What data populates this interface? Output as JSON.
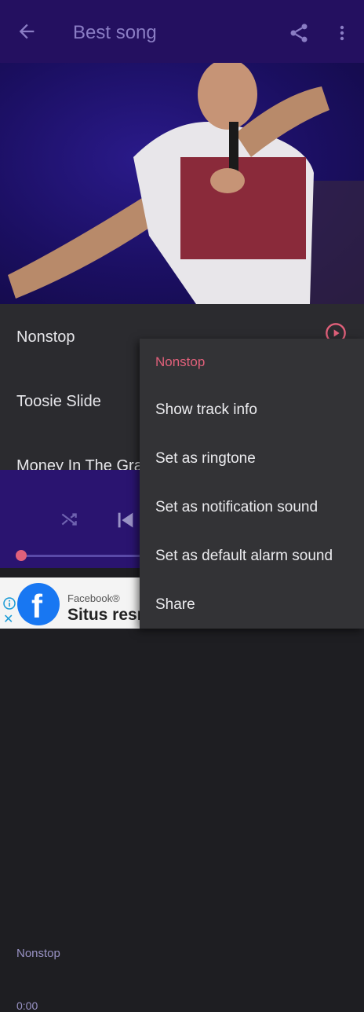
{
  "appbar": {
    "title": "Best song"
  },
  "tracks": [
    "Nonstop",
    "Toosie Slide",
    "Money In The Gra"
  ],
  "player": {
    "now_playing": "Nonstop",
    "elapsed": "0:00",
    "progress": 0
  },
  "ad": {
    "sponsor": "Facebook®",
    "headline": "Situs resmi",
    "logo_letter": "f",
    "close": "✕"
  },
  "menu": {
    "header": "Nonstop",
    "items": [
      "Show track info",
      "Set as ringtone",
      "Set as notification sound",
      "Set as default alarm sound",
      "Share"
    ]
  },
  "colors": {
    "appbar": "#241060",
    "accent": "#e0607a",
    "player_bg": "#2a1470",
    "menu_bg": "#333336"
  },
  "icons": [
    "back-arrow-icon",
    "share-icon",
    "more-vert-icon",
    "play-circle-icon",
    "shuffle-icon",
    "skip-previous-icon",
    "ad-info-icon",
    "close-icon"
  ]
}
